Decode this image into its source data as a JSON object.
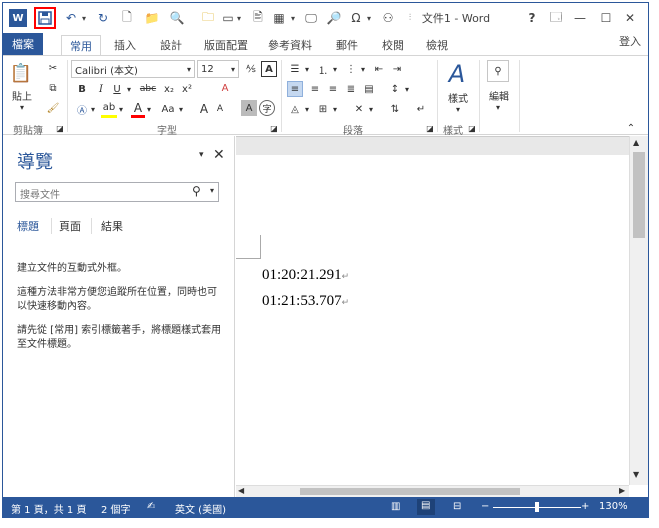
{
  "titlebar": {
    "doc_title": "文件1 - Word",
    "help": "?",
    "restore_ribbon": "🗔",
    "minimize": "—",
    "maximize": "☐",
    "close": "✕",
    "signin": "登入"
  },
  "tabs": {
    "file": "檔案",
    "home": "常用",
    "insert": "插入",
    "design": "設計",
    "layout": "版面配置",
    "references": "參考資料",
    "mailings": "郵件",
    "review": "校閱",
    "view": "檢視"
  },
  "ribbon": {
    "paste": "貼上",
    "font_name": "Calibri (本文)",
    "font_size": "12",
    "bold": "B",
    "italic": "I",
    "underline": "U",
    "strike": "abc",
    "subscript": "x₂",
    "superscript": "x²",
    "grow": "A",
    "shrink": "A",
    "clear": "A",
    "aa": "Aa",
    "styles": "樣式",
    "editing": "編輯",
    "groups": {
      "clipboard": "剪貼簿",
      "font": "字型",
      "paragraph": "段落",
      "styles": "樣式"
    }
  },
  "nav": {
    "title": "導覽",
    "search_placeholder": "搜尋文件",
    "tabs": [
      "標題",
      "頁面",
      "結果"
    ],
    "help1": "建立文件的互動式外框。",
    "help2": "這種方法非常方便您追蹤所在位置，同時也可以快速移動內容。",
    "help3": "請先從 [常用] 索引標籤著手，將標題樣式套用至文件標題。"
  },
  "document": {
    "lines": [
      "01:20:21.291",
      "01:21:53.707"
    ]
  },
  "status": {
    "page": "第 1 頁，共 1 頁",
    "words": "2 個字",
    "language": "英文 (美國)",
    "zoom": "130%"
  },
  "colors": {
    "accent": "#2b579a",
    "highlight_box": "#ff0000"
  }
}
